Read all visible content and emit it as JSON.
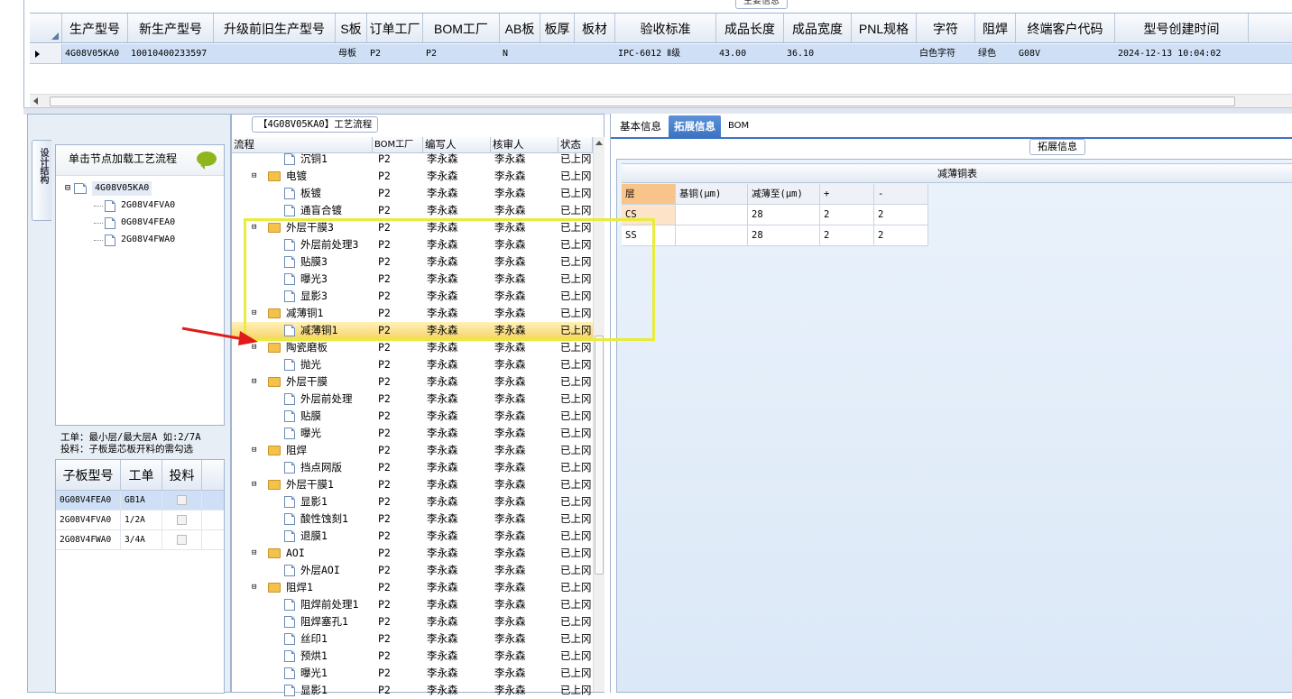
{
  "main_grid": {
    "legend": "主要信息",
    "columns": [
      "生产型号",
      "新生产型号",
      "升级前旧生产型号",
      "S板",
      "订单工厂",
      "BOM工厂",
      "AB板",
      "板厚",
      "板材",
      "验收标准",
      "成品长度",
      "成品宽度",
      "PNL规格",
      "字符",
      "阻焊",
      "终端客户代码",
      "型号创建时间"
    ],
    "row": [
      "4G08V05KA0",
      "10010400233597",
      "",
      "母板",
      "P2",
      "P2",
      "N",
      "",
      "",
      "IPC-6012 Ⅱ级",
      "43.00",
      "36.10",
      "",
      "白色字符",
      "绿色",
      "G08V",
      "2024-12-13 10:04:02"
    ]
  },
  "left_panel": {
    "side_tab": "设计结构",
    "tree_header": "单击节点加载工艺流程",
    "root": "4G08V05KA0",
    "children": [
      "2G08V4FVA0",
      "0G08V4FEA0",
      "2G08V4FWA0"
    ],
    "note_line1": "工单：最小层/最大层A 如:2/7A",
    "note_line2": "投料：子板是芯板开料的需勾选",
    "sub_headers": [
      "子板型号",
      "工单",
      "投料"
    ],
    "sub_rows": [
      {
        "model": "0G08V4FEA0",
        "order": "GB1A"
      },
      {
        "model": "2G08V4FVA0",
        "order": "1/2A"
      },
      {
        "model": "2G08V4FWA0",
        "order": "3/4A"
      }
    ]
  },
  "flow": {
    "caption": "【4G08V05KA0】工艺流程",
    "headers": [
      "流程",
      "BOM工厂",
      "编写人",
      "核审人",
      "状态"
    ],
    "rows": [
      {
        "name": "沉铜1",
        "type": "doc",
        "f": "P2",
        "w": "李永森",
        "r": "李永森",
        "s": "已上冈"
      },
      {
        "name": "电镀",
        "type": "folder",
        "f": "P2",
        "w": "李永森",
        "r": "李永森",
        "s": "已上冈"
      },
      {
        "name": "板镀",
        "type": "doc",
        "f": "P2",
        "w": "李永森",
        "r": "李永森",
        "s": "已上冈"
      },
      {
        "name": "通盲合镀",
        "type": "doc",
        "f": "P2",
        "w": "李永森",
        "r": "李永森",
        "s": "已上冈"
      },
      {
        "name": "外层干膜3",
        "type": "folder",
        "f": "P2",
        "w": "李永森",
        "r": "李永森",
        "s": "已上冈"
      },
      {
        "name": "外层前处理3",
        "type": "doc",
        "f": "P2",
        "w": "李永森",
        "r": "李永森",
        "s": "已上冈"
      },
      {
        "name": "贴膜3",
        "type": "doc",
        "f": "P2",
        "w": "李永森",
        "r": "李永森",
        "s": "已上冈"
      },
      {
        "name": "曝光3",
        "type": "doc",
        "f": "P2",
        "w": "李永森",
        "r": "李永森",
        "s": "已上冈"
      },
      {
        "name": "显影3",
        "type": "doc",
        "f": "P2",
        "w": "李永森",
        "r": "李永森",
        "s": "已上冈"
      },
      {
        "name": "减薄铜1",
        "type": "folder",
        "f": "P2",
        "w": "李永森",
        "r": "李永森",
        "s": "已上冈"
      },
      {
        "name": "减薄铜1",
        "type": "doc",
        "f": "P2",
        "w": "李永森",
        "r": "李永森",
        "s": "已上冈",
        "hl": true
      },
      {
        "name": "陶瓷磨板",
        "type": "folder",
        "f": "P2",
        "w": "李永森",
        "r": "李永森",
        "s": "已上冈"
      },
      {
        "name": "抛光",
        "type": "doc",
        "f": "P2",
        "w": "李永森",
        "r": "李永森",
        "s": "已上冈"
      },
      {
        "name": "外层干膜",
        "type": "folder",
        "f": "P2",
        "w": "李永森",
        "r": "李永森",
        "s": "已上冈"
      },
      {
        "name": "外层前处理",
        "type": "doc",
        "f": "P2",
        "w": "李永森",
        "r": "李永森",
        "s": "已上冈"
      },
      {
        "name": "贴膜",
        "type": "doc",
        "f": "P2",
        "w": "李永森",
        "r": "李永森",
        "s": "已上冈"
      },
      {
        "name": "曝光",
        "type": "doc",
        "f": "P2",
        "w": "李永森",
        "r": "李永森",
        "s": "已上冈"
      },
      {
        "name": "阻焊",
        "type": "folder",
        "f": "P2",
        "w": "李永森",
        "r": "李永森",
        "s": "已上冈"
      },
      {
        "name": "挡点网版",
        "type": "doc",
        "f": "P2",
        "w": "李永森",
        "r": "李永森",
        "s": "已上冈"
      },
      {
        "name": "外层干膜1",
        "type": "folder",
        "f": "P2",
        "w": "李永森",
        "r": "李永森",
        "s": "已上冈"
      },
      {
        "name": "显影1",
        "type": "doc",
        "f": "P2",
        "w": "李永森",
        "r": "李永森",
        "s": "已上冈"
      },
      {
        "name": "酸性蚀刻1",
        "type": "doc",
        "f": "P2",
        "w": "李永森",
        "r": "李永森",
        "s": "已上冈"
      },
      {
        "name": "退膜1",
        "type": "doc",
        "f": "P2",
        "w": "李永森",
        "r": "李永森",
        "s": "已上冈"
      },
      {
        "name": "AOI",
        "type": "folder",
        "f": "P2",
        "w": "李永森",
        "r": "李永森",
        "s": "已上冈"
      },
      {
        "name": "外层AOI",
        "type": "doc",
        "f": "P2",
        "w": "李永森",
        "r": "李永森",
        "s": "已上冈"
      },
      {
        "name": "阻焊1",
        "type": "folder",
        "f": "P2",
        "w": "李永森",
        "r": "李永森",
        "s": "已上冈"
      },
      {
        "name": "阻焊前处理1",
        "type": "doc",
        "f": "P2",
        "w": "李永森",
        "r": "李永森",
        "s": "已上冈"
      },
      {
        "name": "阻焊塞孔1",
        "type": "doc",
        "f": "P2",
        "w": "李永森",
        "r": "李永森",
        "s": "已上冈"
      },
      {
        "name": "丝印1",
        "type": "doc",
        "f": "P2",
        "w": "李永森",
        "r": "李永森",
        "s": "已上冈"
      },
      {
        "name": "预烘1",
        "type": "doc",
        "f": "P2",
        "w": "李永森",
        "r": "李永森",
        "s": "已上冈"
      },
      {
        "name": "曝光1",
        "type": "doc",
        "f": "P2",
        "w": "李永森",
        "r": "李永森",
        "s": "已上冈"
      },
      {
        "name": "显影1",
        "type": "doc",
        "f": "P2",
        "w": "李永森",
        "r": "李永森",
        "s": "已上冈"
      }
    ]
  },
  "right_panel": {
    "tabs": [
      "基本信息",
      "拓展信息",
      "BOM"
    ],
    "active_tab": "拓展信息",
    "legend": "拓展信息",
    "table_title": "减薄铜表",
    "headers": [
      "层",
      "基铜(μm)",
      "减薄至(μm)",
      "+",
      "-"
    ],
    "rows": [
      [
        "CS",
        "",
        "28",
        "2",
        "2"
      ],
      [
        "SS",
        "",
        "28",
        "2",
        "2"
      ]
    ]
  },
  "colors": {
    "accent": "#3c74c4",
    "highlight_box": "#e8ec3a",
    "arrow": "#e11a1a",
    "selected_row": "#cfe0f6"
  }
}
